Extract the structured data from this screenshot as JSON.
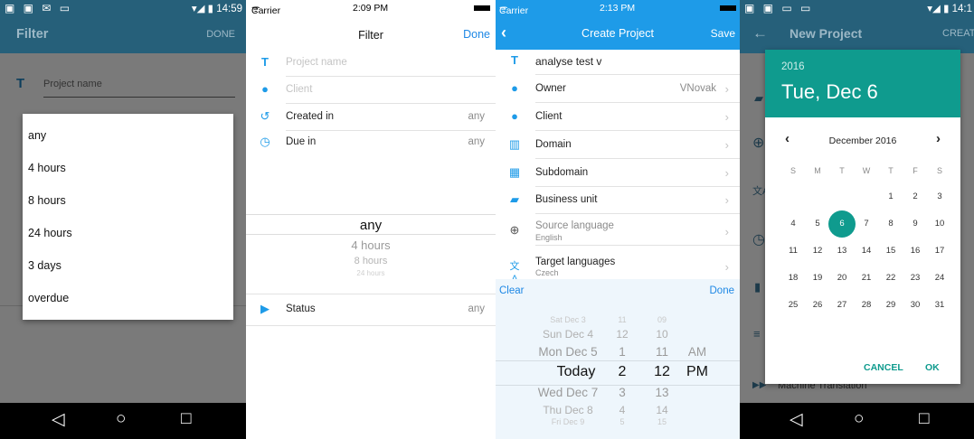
{
  "android_filter": {
    "status_left": "▣ ▣ ✉ ▭",
    "time": "14:59",
    "title": "Filter",
    "done": "DONE",
    "project_placeholder": "Project name",
    "options": [
      "any",
      "4 hours",
      "8 hours",
      "24 hours",
      "3 days",
      "overdue"
    ]
  },
  "ios_filter": {
    "carrier": "Carrier",
    "time": "2:09 PM",
    "title": "Filter",
    "done": "Done",
    "project_placeholder": "Project name",
    "client_placeholder": "Client",
    "created_label": "Created in",
    "created_value": "any",
    "due_label": "Due in",
    "due_value": "any",
    "picker": [
      "any",
      "4 hours",
      "8 hours",
      "24 hours"
    ],
    "status_label": "Status",
    "status_value": "any"
  },
  "ios_create": {
    "carrier": "Carrier",
    "time": "2:13 PM",
    "title": "Create Project",
    "save": "Save",
    "project_name": "analyse test v",
    "owner_label": "Owner",
    "owner_value": "VNovak",
    "client_label": "Client",
    "domain_label": "Domain",
    "subdomain_label": "Subdomain",
    "business_unit_label": "Business unit",
    "source_label": "Source language",
    "source_value": "English",
    "target_label": "Target languages",
    "target_value": "Czech",
    "clear": "Clear",
    "done": "Done",
    "picker_dates": [
      "Sat Dec 3",
      "Sun Dec 4",
      "Mon Dec 5",
      "Today",
      "Wed Dec 7",
      "Thu Dec 8",
      "Fri Dec 9"
    ],
    "picker_hours": [
      "11",
      "12",
      "1",
      "2",
      "3",
      "4",
      "5"
    ],
    "picker_minutes": [
      "09",
      "10",
      "11",
      "12",
      "13",
      "14",
      "15"
    ],
    "picker_ampm": [
      "AM",
      "PM"
    ]
  },
  "android_new": {
    "status_left": "▣ ▣ ▭ ▭",
    "time": "14:1",
    "title": "New Project",
    "action": "CREATE",
    "behind_label": "Machine Translation",
    "year": "2016",
    "date_heading": "Tue, Dec 6",
    "month": "December 2016",
    "weekdays": [
      "S",
      "M",
      "T",
      "W",
      "T",
      "F",
      "S"
    ],
    "days": [
      "1",
      "2",
      "3",
      "4",
      "5",
      "6",
      "7",
      "8",
      "9",
      "10",
      "11",
      "12",
      "13",
      "14",
      "15",
      "16",
      "17",
      "18",
      "19",
      "20",
      "21",
      "22",
      "23",
      "24",
      "25",
      "26",
      "27",
      "28",
      "29",
      "30",
      "31"
    ],
    "selected_day": "6",
    "cancel": "CANCEL",
    "ok": "OK",
    "accent": "#0f9b8e"
  },
  "icons": [
    "back-icon",
    "home-icon",
    "recents-icon",
    "chevron-left-icon",
    "chevron-right-icon",
    "text-icon",
    "person-icon",
    "clock-icon",
    "history-icon",
    "tag-icon",
    "building-icon",
    "grid-icon",
    "briefcase-icon",
    "globe-icon",
    "translate-icon"
  ]
}
